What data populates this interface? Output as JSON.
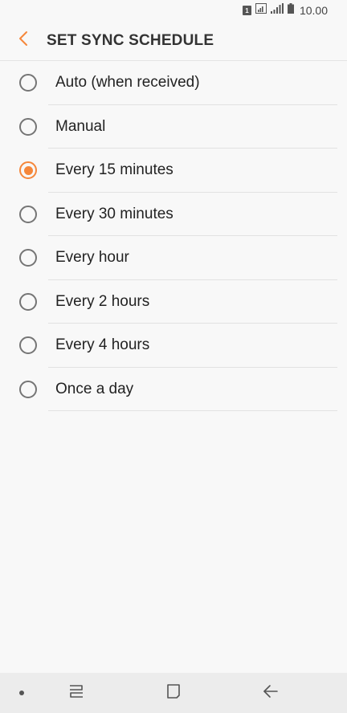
{
  "status_bar": {
    "sim_label": "1",
    "time": "10.00",
    "icons": [
      "sim-icon",
      "wifi-icon",
      "signal-icon",
      "battery-icon"
    ]
  },
  "header": {
    "back_icon": "chevron-left-icon",
    "title": "SET SYNC SCHEDULE"
  },
  "options": [
    {
      "label": "Auto (when received)",
      "selected": false
    },
    {
      "label": "Manual",
      "selected": false
    },
    {
      "label": "Every 15 minutes",
      "selected": true
    },
    {
      "label": "Every 30 minutes",
      "selected": false
    },
    {
      "label": "Every hour",
      "selected": false
    },
    {
      "label": "Every 2 hours",
      "selected": false
    },
    {
      "label": "Every 4 hours",
      "selected": false
    },
    {
      "label": "Once a day",
      "selected": false
    }
  ],
  "nav_bar": {
    "icons": [
      "dot-icon",
      "recents-icon",
      "home-icon",
      "back-arrow-icon"
    ]
  },
  "colors": {
    "accent": "#f5873b",
    "background": "#f8f8f8",
    "nav_background": "#ececec"
  }
}
